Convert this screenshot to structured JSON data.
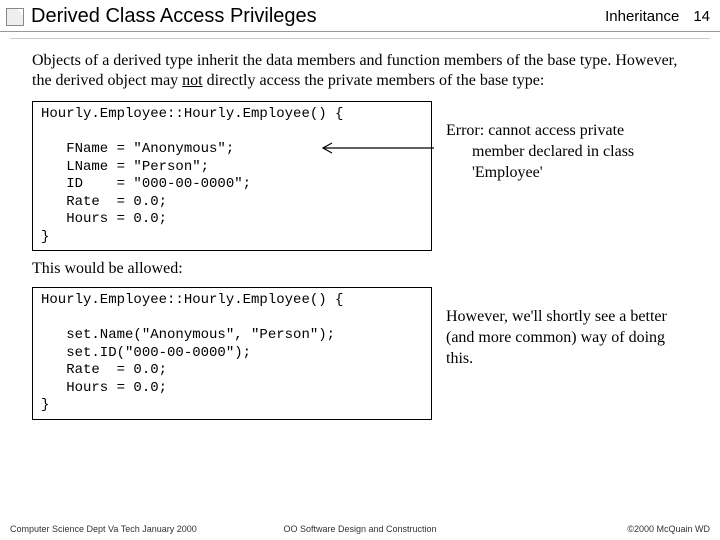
{
  "header": {
    "title": "Derived Class Access Privileges",
    "breadcrumb": "Inheritance",
    "slide": "14"
  },
  "intro": {
    "part1": "Objects of a derived type inherit the data members and function members of the base type.  However, the derived object may ",
    "not": "not",
    "part2": " directly access the private members of the base type:"
  },
  "code1": "Hourly.Employee::Hourly.Employee() {\n\n   FName = \"Anonymous\";\n   LName = \"Person\";\n   ID    = \"000-00-0000\";\n   Rate  = 0.0;\n   Hours = 0.0;\n}",
  "error": {
    "line1": "Error:  cannot access private",
    "line2": "member declared in class",
    "line3": "'Employee'"
  },
  "between": "This would be allowed:",
  "code2": "Hourly.Employee::Hourly.Employee() {\n\n   set.Name(\"Anonymous\", \"Person\");\n   set.ID(\"000-00-0000\");\n   Rate  = 0.0;\n   Hours = 0.0;\n}",
  "note2": "However, we'll shortly see a better (and more common) way of doing this.",
  "footer": {
    "left": "Computer Science Dept Va Tech January 2000",
    "center": "OO Software Design and Construction",
    "right": "©2000 McQuain WD"
  }
}
